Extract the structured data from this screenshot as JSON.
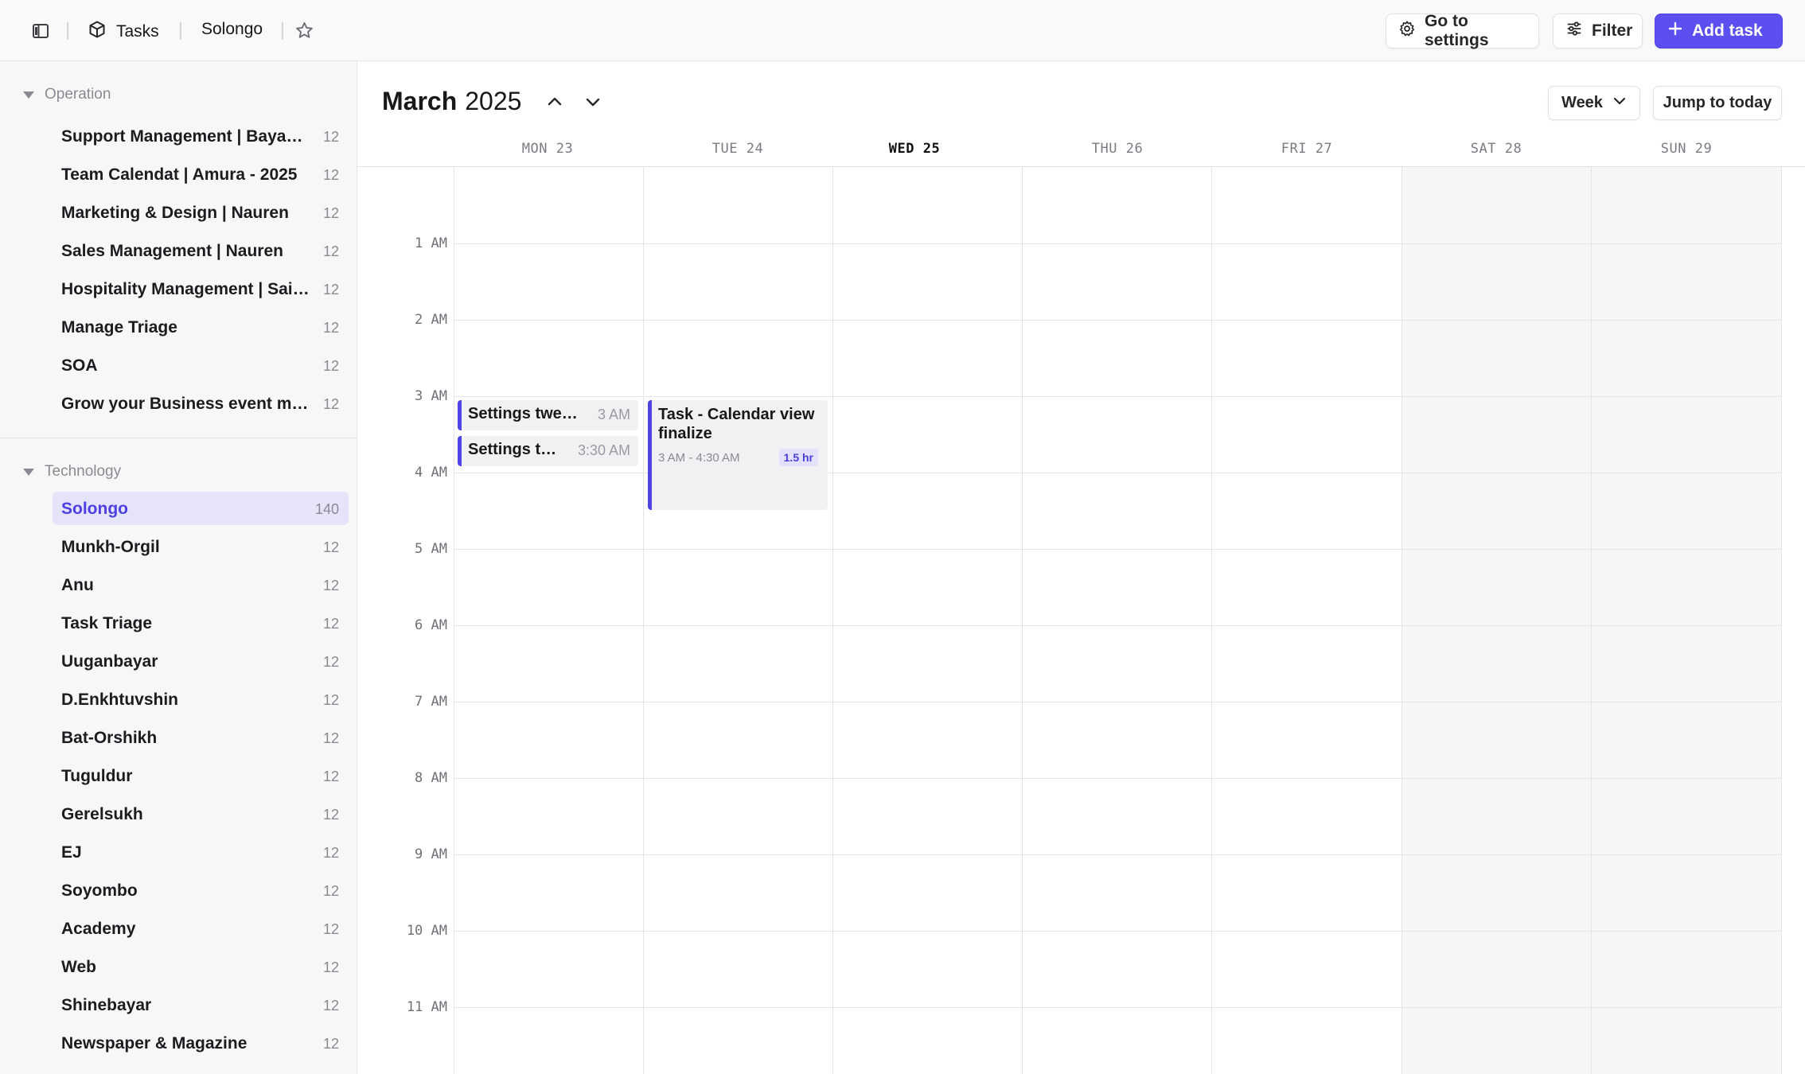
{
  "header": {
    "breadcrumb_root": "Tasks",
    "breadcrumb_current": "Solongo",
    "settings_label": "Go to settings",
    "filter_label": "Filter",
    "add_task_label": "Add task",
    "icons": {
      "sidebar_toggle": "sidebar-toggle-icon",
      "tasks": "cube-icon",
      "favorite": "star-icon",
      "settings": "gear-icon",
      "filter": "sliders-icon",
      "add": "plus-icon"
    }
  },
  "sidebar": {
    "groups": [
      {
        "name": "Operation",
        "items": [
          {
            "label": "Support Management | Bayasgalan",
            "count": "12"
          },
          {
            "label": "Team Calendat | Amura - 2025",
            "count": "12"
          },
          {
            "label": "Marketing & Design | Nauren",
            "count": "12"
          },
          {
            "label": "Sales Management | Nauren",
            "count": "12"
          },
          {
            "label": "Hospitality Management | Saikhanbileg",
            "count": "12"
          },
          {
            "label": "Manage Triage",
            "count": "12"
          },
          {
            "label": "SOA",
            "count": "12"
          },
          {
            "label": "Grow your Business event management",
            "count": "12"
          }
        ]
      },
      {
        "name": "Technology",
        "items": [
          {
            "label": "Solongo",
            "count": "140",
            "active": true
          },
          {
            "label": "Munkh-Orgil",
            "count": "12"
          },
          {
            "label": "Anu",
            "count": "12"
          },
          {
            "label": "Task Triage",
            "count": "12"
          },
          {
            "label": "Uuganbayar",
            "count": "12"
          },
          {
            "label": "D.Enkhtuvshin",
            "count": "12"
          },
          {
            "label": "Bat-Orshikh",
            "count": "12"
          },
          {
            "label": "Tuguldur",
            "count": "12"
          },
          {
            "label": "Gerelsukh",
            "count": "12"
          },
          {
            "label": "EJ",
            "count": "12"
          },
          {
            "label": "Soyombo",
            "count": "12"
          },
          {
            "label": "Academy",
            "count": "12"
          },
          {
            "label": "Web",
            "count": "12"
          },
          {
            "label": "Shinebayar",
            "count": "12"
          },
          {
            "label": "Newspaper & Magazine",
            "count": "12"
          }
        ]
      }
    ]
  },
  "calendar": {
    "month": "March",
    "year": "2025",
    "view_label": "Week",
    "jump_label": "Jump to today",
    "days": [
      {
        "label": "MON 23",
        "today": false,
        "weekend": false
      },
      {
        "label": "TUE 24",
        "today": false,
        "weekend": false
      },
      {
        "label": "WED 25",
        "today": true,
        "weekend": false
      },
      {
        "label": "THU 26",
        "today": false,
        "weekend": false
      },
      {
        "label": "FRI 27",
        "today": false,
        "weekend": false
      },
      {
        "label": "SAT 28",
        "today": false,
        "weekend": true
      },
      {
        "label": "SUN 29",
        "today": false,
        "weekend": true
      }
    ],
    "hours": [
      "1 AM",
      "2 AM",
      "3 AM",
      "4 AM",
      "5 AM",
      "6 AM",
      "7 AM",
      "8 AM",
      "9 AM",
      "10 AM",
      "11 AM"
    ],
    "events": [
      {
        "title": "Settings tweaks",
        "time": "3 AM",
        "day": 0
      },
      {
        "title": "Settings tweaks",
        "time": "3:30 AM",
        "day": 0
      },
      {
        "title": "Task - Calendar view finalize",
        "range": "3 AM - 4:30 AM",
        "duration": "1.5 hr",
        "day": 1
      }
    ],
    "accent_color": "#5b4ff0"
  }
}
